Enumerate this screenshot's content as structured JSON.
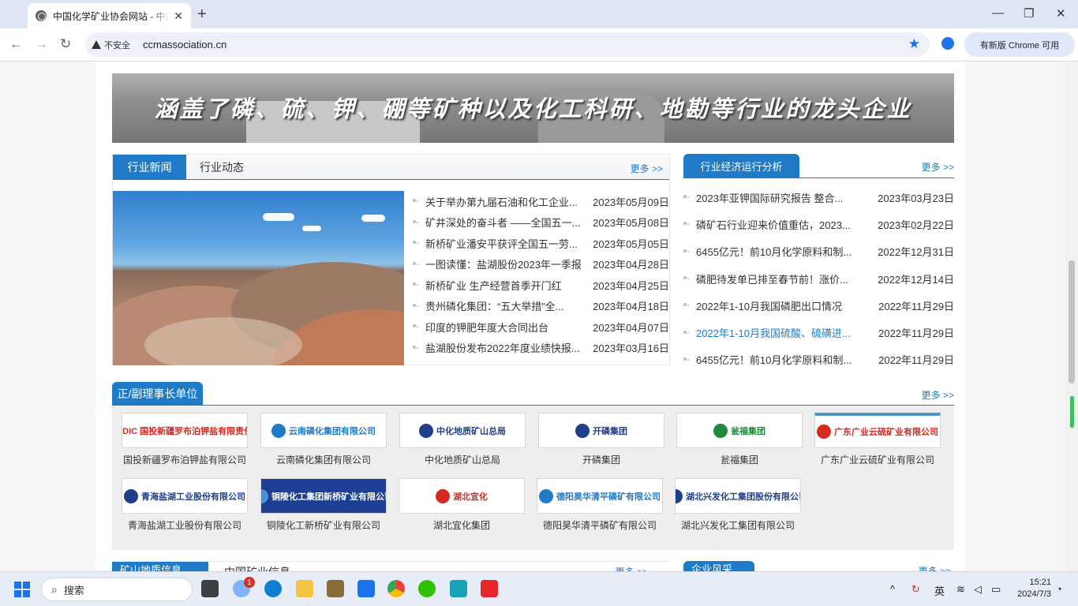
{
  "browser": {
    "tab_title": "中国化学矿业协会网站 - 中国化",
    "security_label": "不安全",
    "url": "ccmassociation.cn",
    "update_button": "有新版 Chrome 可用",
    "new_tab": "+",
    "close_tab": "✕",
    "minimize": "—",
    "maximize": "❐",
    "close_window": "✕"
  },
  "banner": {
    "text": "涵盖了磷、硫、钾、硼等矿种以及化工科研、地勘等行业的龙头企业"
  },
  "news": {
    "tabs": [
      "行业新闻",
      "行业动态"
    ],
    "more": "更多 >>",
    "items": [
      {
        "title": "关于举办第九届石油和化工企业...",
        "date": "2023年05月09日"
      },
      {
        "title": "矿井深处的奋斗者 ——全国五一...",
        "date": "2023年05月08日"
      },
      {
        "title": "新桥矿业潘安平获评全国五一劳...",
        "date": "2023年05月05日"
      },
      {
        "title": "一图读懂：盐湖股份2023年一季报",
        "date": "2023年04月28日"
      },
      {
        "title": "新桥矿业 生产经营首季开门红",
        "date": "2023年04月25日"
      },
      {
        "title": "贵州磷化集团：“五大举措”全...",
        "date": "2023年04月18日"
      },
      {
        "title": "印度的钾肥年度大合同出台",
        "date": "2023年04月07日"
      },
      {
        "title": "盐湖股份发布2022年度业绩快报...",
        "date": "2023年03月16日"
      }
    ]
  },
  "analysis": {
    "tab": "行业经济运行分析",
    "more": "更多 >>",
    "items": [
      {
        "title": "2023年亚钾国际研究报告 整合...",
        "date": "2023年03月23日"
      },
      {
        "title": "磷矿石行业迎来价值重估，2023...",
        "date": "2023年02月22日"
      },
      {
        "title": "6455亿元！前10月化学原料和制...",
        "date": "2022年12月31日"
      },
      {
        "title": "磷肥待发单已排至春节前！涨价...",
        "date": "2022年12月14日"
      },
      {
        "title": "2022年1-10月我国磷肥出口情况",
        "date": "2022年11月29日"
      },
      {
        "title": "2022年1-10月我国硫酸、硫磺进...",
        "date": "2022年11月29日"
      },
      {
        "title": "6455亿元！前10月化学原料和制...",
        "date": "2022年11月29日"
      }
    ]
  },
  "members": {
    "tab": "正/副理事长单位",
    "more": "更多 >>",
    "items": [
      {
        "logo": "SDIC 国投新疆罗布泊钾盐有限责任公司",
        "name": "国投新疆罗布泊钾盐有限公司",
        "color": "#d42a20"
      },
      {
        "logo": "云南磷化集团有限公司",
        "name": "云南磷化集团有限公司",
        "color": "#1f7ac7"
      },
      {
        "logo": "中化地质矿山总局",
        "name": "中化地质矿山总局",
        "color": "#1f3f8a"
      },
      {
        "logo": "开磷集团",
        "name": "开磷集团",
        "color": "#1f3f8a"
      },
      {
        "logo": "瓮福集团",
        "name": "瓮福集团",
        "color": "#1e8a3a"
      },
      {
        "logo": "广东广业云硫矿业有限公司",
        "name": "广东广业云硫矿业有限公司",
        "color": "#d42a20"
      },
      {
        "logo": "青海盐湖工业股份有限公司",
        "name": "青海盐湖工业股份有限公司",
        "color": "#1f3f8a"
      },
      {
        "logo": "铜陵化工集团新桥矿业有限公司",
        "name": "铜陵化工新桥矿业有限公司",
        "color": "#ffffff"
      },
      {
        "logo": "湖北宜化",
        "name": "湖北宜化集团",
        "color": "#d42a20"
      },
      {
        "logo": "德阳昊华清平磷矿有限公司",
        "name": "德阳昊华清平磷矿有限公司",
        "color": "#1f7ac7"
      },
      {
        "logo": "湖北兴发化工集团股份有限公司",
        "name": "湖北兴发化工集团有限公司",
        "color": "#1f3f8a"
      }
    ]
  },
  "bottom": {
    "left_tab": "矿山地质信息",
    "left_tab2": "中国矿业信息",
    "more": "更多 >>",
    "right_tab": "企业风采",
    "right_more": "更多 >>"
  },
  "taskbar": {
    "search": "搜索",
    "badge": "1",
    "ime": "英",
    "time": "15:21",
    "date": "2024/7/3"
  },
  "colors": {
    "accent": "#1f7ac7",
    "link_highlight": "#1f7ac7"
  }
}
